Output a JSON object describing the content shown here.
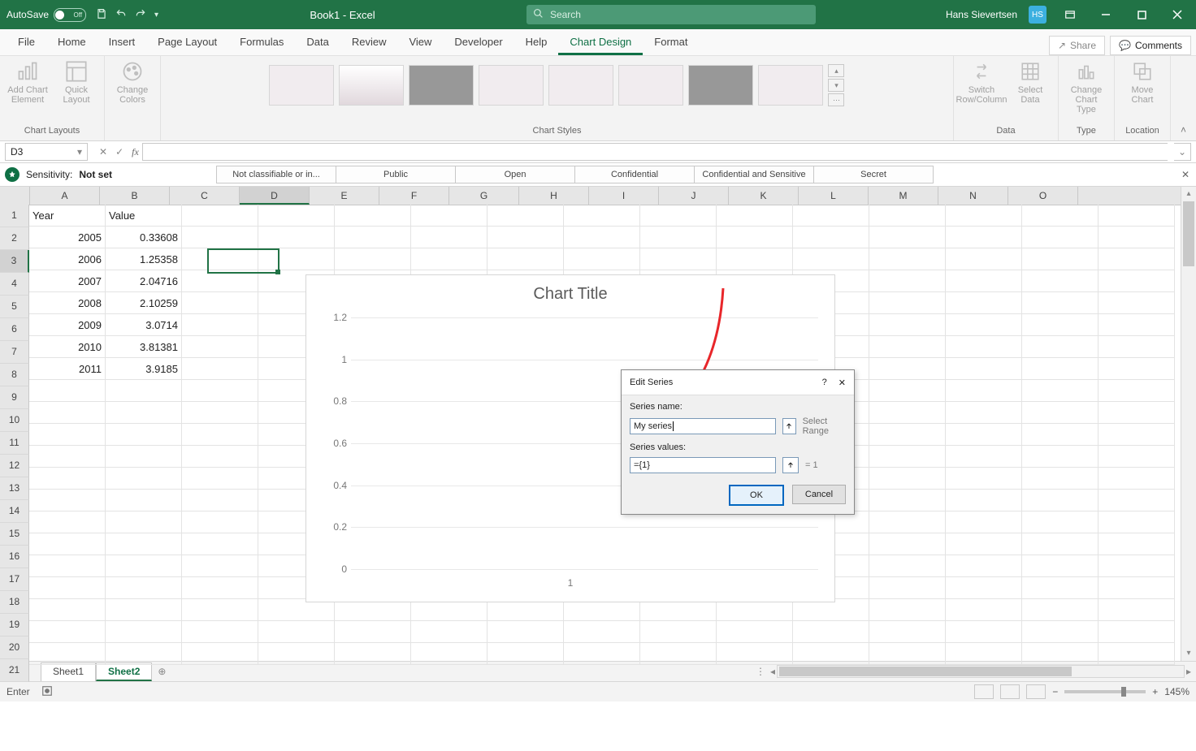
{
  "titlebar": {
    "autosave_label": "AutoSave",
    "autosave_off": "Off",
    "doc_title": "Book1 - Excel",
    "search_placeholder": "Search",
    "user_name": "Hans Sievertsen",
    "user_initials": "HS"
  },
  "tabs": [
    "File",
    "Home",
    "Insert",
    "Page Layout",
    "Formulas",
    "Data",
    "Review",
    "View",
    "Developer",
    "Help",
    "Chart Design",
    "Format"
  ],
  "active_tab": "Chart Design",
  "share_label": "Share",
  "comments_label": "Comments",
  "ribbon": {
    "chart_layouts": {
      "label": "Chart Layouts",
      "add_element": "Add Chart Element",
      "quick_layout": "Quick Layout"
    },
    "change_colors": "Change Colors",
    "styles_label": "Chart Styles",
    "data": {
      "label": "Data",
      "switch": "Switch Row/Column",
      "select": "Select Data"
    },
    "type": {
      "label": "Type",
      "change": "Change Chart Type"
    },
    "location": {
      "label": "Location",
      "move": "Move Chart"
    }
  },
  "namebox": "D3",
  "sensitivity": {
    "label": "Sensitivity:",
    "value": "Not set",
    "buttons": [
      "Not classifiable or in...",
      "Public",
      "Open",
      "Confidential",
      "Confidential and Sensitive",
      "Secret"
    ]
  },
  "columns": [
    "A",
    "B",
    "C",
    "D",
    "E",
    "F",
    "G",
    "H",
    "I",
    "J",
    "K",
    "L",
    "M",
    "N",
    "O"
  ],
  "selected_col": "D",
  "rows": [
    1,
    2,
    3,
    4,
    5,
    6,
    7,
    8,
    9,
    10,
    11,
    12,
    13,
    14,
    15,
    16,
    17,
    18,
    19,
    20,
    21
  ],
  "selected_row": 3,
  "data_rows": [
    {
      "A": "Year",
      "B": "Value"
    },
    {
      "A": "2005",
      "B": "0.33608"
    },
    {
      "A": "2006",
      "B": "1.25358"
    },
    {
      "A": "2007",
      "B": "2.04716"
    },
    {
      "A": "2008",
      "B": "2.10259"
    },
    {
      "A": "2009",
      "B": "3.0714"
    },
    {
      "A": "2010",
      "B": "3.81381"
    },
    {
      "A": "2011",
      "B": "3.9185"
    }
  ],
  "chart": {
    "title": "Chart Title",
    "y_ticks": [
      "1.2",
      "1",
      "0.8",
      "0.6",
      "0.4",
      "0.2",
      "0"
    ],
    "x_tick": "1"
  },
  "dialog": {
    "title": "Edit Series",
    "help": "?",
    "name_label": "Series name:",
    "name_value": "My series",
    "name_hint": "Select Range",
    "values_label": "Series values:",
    "values_value": "={1}",
    "values_hint": "= 1",
    "ok": "OK",
    "cancel": "Cancel"
  },
  "sheets": [
    "Sheet1",
    "Sheet2"
  ],
  "active_sheet": "Sheet2",
  "status": {
    "mode": "Enter",
    "zoom": "145%"
  },
  "chart_data": {
    "type": "line",
    "title": "Chart Title",
    "x": [
      1
    ],
    "series": [
      {
        "name": "My series",
        "values": [
          1
        ]
      }
    ],
    "ylim": [
      0,
      1.2
    ],
    "y_ticks": [
      0,
      0.2,
      0.4,
      0.6,
      0.8,
      1,
      1.2
    ]
  }
}
